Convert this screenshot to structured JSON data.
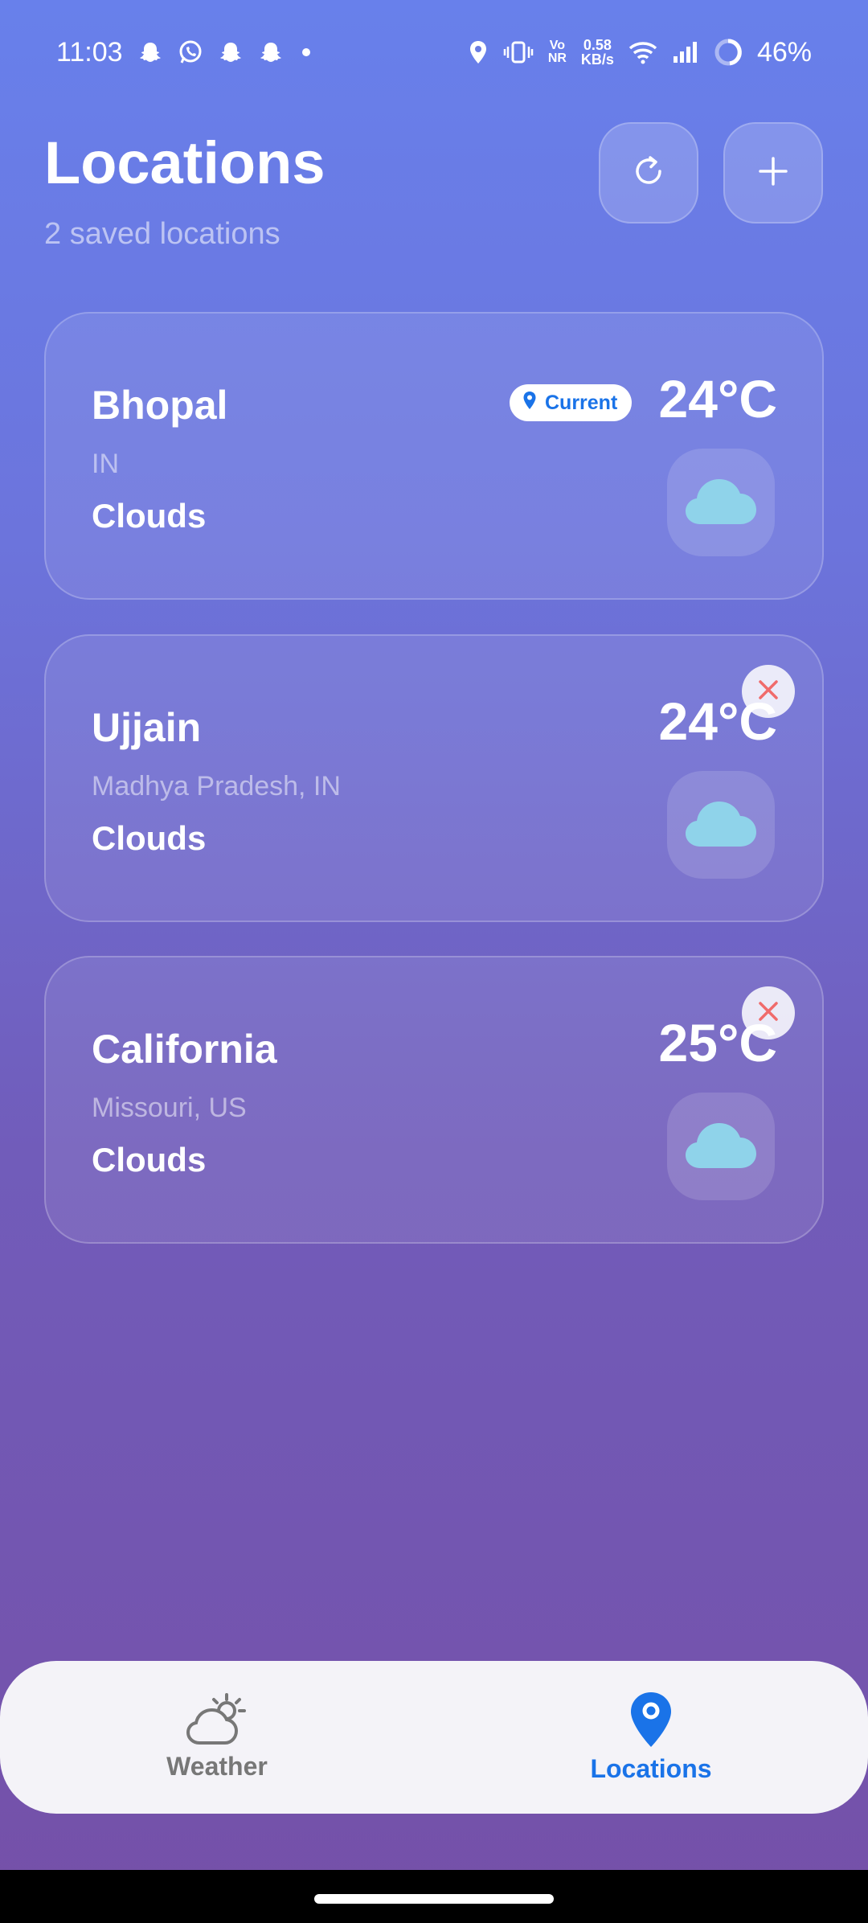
{
  "status_bar": {
    "time": "11:03",
    "notification_icons": [
      "snapchat-icon",
      "whatsapp-icon",
      "snapchat-icon",
      "snapchat-icon",
      "dot-icon"
    ],
    "network_speed_value": "0.58",
    "network_speed_unit": "KB/s",
    "volte_top": "Vo",
    "volte_bottom": "NR",
    "battery": "46%"
  },
  "header": {
    "title": "Locations",
    "subtitle": "2 saved locations",
    "refresh_icon": "refresh-icon",
    "add_icon": "plus-icon"
  },
  "locations": [
    {
      "city": "Bhopal",
      "region": "IN",
      "condition": "Clouds",
      "temperature": "24°C",
      "badge": "Current",
      "icon": "cloud-icon"
    },
    {
      "city": "Ujjain",
      "region": "Madhya Pradesh, IN",
      "condition": "Clouds",
      "temperature": "24°C",
      "icon": "cloud-icon"
    },
    {
      "city": "California",
      "region": "Missouri, US",
      "condition": "Clouds",
      "temperature": "25°C",
      "icon": "cloud-icon"
    }
  ],
  "bottom_nav": {
    "items": [
      {
        "label": "Weather",
        "icon": "partly-cloudy-icon",
        "active": false
      },
      {
        "label": "Locations",
        "icon": "location-pin-icon",
        "active": true
      }
    ]
  },
  "colors": {
    "background_top": "#6880eb",
    "background_bottom": "#7550a8",
    "accent": "#1a73e8",
    "cloud": "#8fd3ea",
    "remove": "#f06b6b"
  }
}
